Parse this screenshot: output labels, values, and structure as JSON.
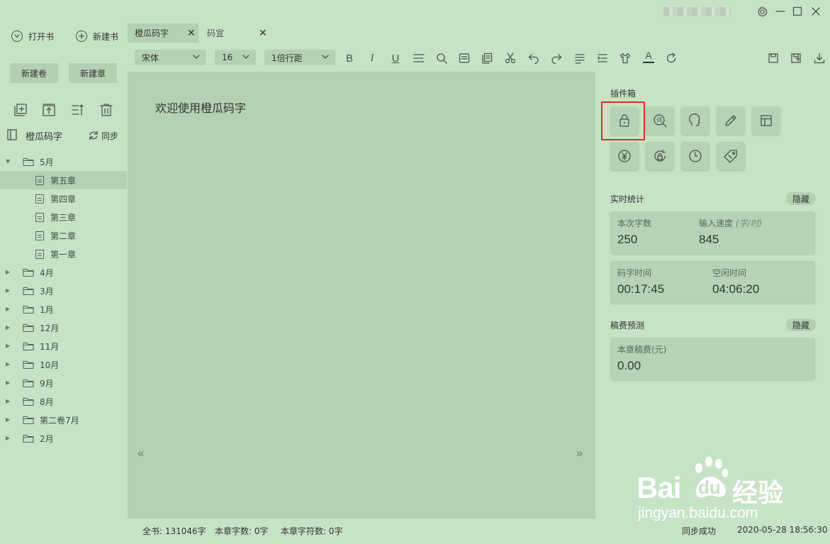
{
  "titlebar": {
    "icons": [
      "settings-icon",
      "minimize-icon",
      "maximize-icon",
      "close-icon"
    ]
  },
  "left": {
    "open_book": "打开书",
    "new_book": "新建书",
    "new_volume": "新建卷",
    "new_chapter": "新建章",
    "book_title": "橙瓜码字",
    "sync": "同步",
    "tree": [
      {
        "type": "folder",
        "label": "5月",
        "expanded": true
      },
      {
        "type": "chapter",
        "label": "第五章",
        "selected": true
      },
      {
        "type": "chapter",
        "label": "第四章"
      },
      {
        "type": "chapter",
        "label": "第三章"
      },
      {
        "type": "chapter",
        "label": "第二章"
      },
      {
        "type": "chapter",
        "label": "第一章"
      },
      {
        "type": "folder",
        "label": "4月"
      },
      {
        "type": "folder",
        "label": "3月"
      },
      {
        "type": "folder",
        "label": "1月"
      },
      {
        "type": "folder",
        "label": "12月"
      },
      {
        "type": "folder",
        "label": "11月"
      },
      {
        "type": "folder",
        "label": "10月"
      },
      {
        "type": "folder",
        "label": "9月"
      },
      {
        "type": "folder",
        "label": "8月"
      },
      {
        "type": "folder",
        "label": "第二卷7月"
      },
      {
        "type": "folder",
        "label": "2月"
      }
    ]
  },
  "tabs": [
    {
      "label": "橙瓜码字",
      "active": true
    },
    {
      "label": "码宣",
      "active": false
    }
  ],
  "toolbar": {
    "font": "宋体",
    "size": "16",
    "line_spacing": "1倍行距"
  },
  "editor": {
    "text": "欢迎使用橙瓜码字",
    "prev": "«",
    "next": "»"
  },
  "right": {
    "plugin_title": "插件箱",
    "realtime_title": "实时统计",
    "hide1": "隐藏",
    "word_count_label": "本次字数",
    "word_count": "250",
    "speed_label": "输入速度",
    "speed_unit": "(字/时)",
    "speed": "845",
    "typing_time_label": "码字时间",
    "typing_time": "00:17:45",
    "idle_time_label": "空闲时间",
    "idle_time": "04:06:20",
    "fee_title": "稿费预测",
    "hide2": "隐藏",
    "fee_label": "本章稿费(元)",
    "fee": "0.00"
  },
  "status": {
    "book_total": "全书: 131046字",
    "chapter_words": "本章字数: 0字",
    "chapter_chars": "本章字符数: 0字",
    "sync_status": "同步成功",
    "datetime": "2020-05-28 18:56:30"
  },
  "watermark": {
    "brand": "Bai",
    "brand2": "du",
    "cn": "经验",
    "url": "jingyan.baidu.com"
  },
  "colors": {
    "background": "#c7e3c6",
    "panel": "#b4d2b3",
    "highlight": "#e62a1f"
  }
}
